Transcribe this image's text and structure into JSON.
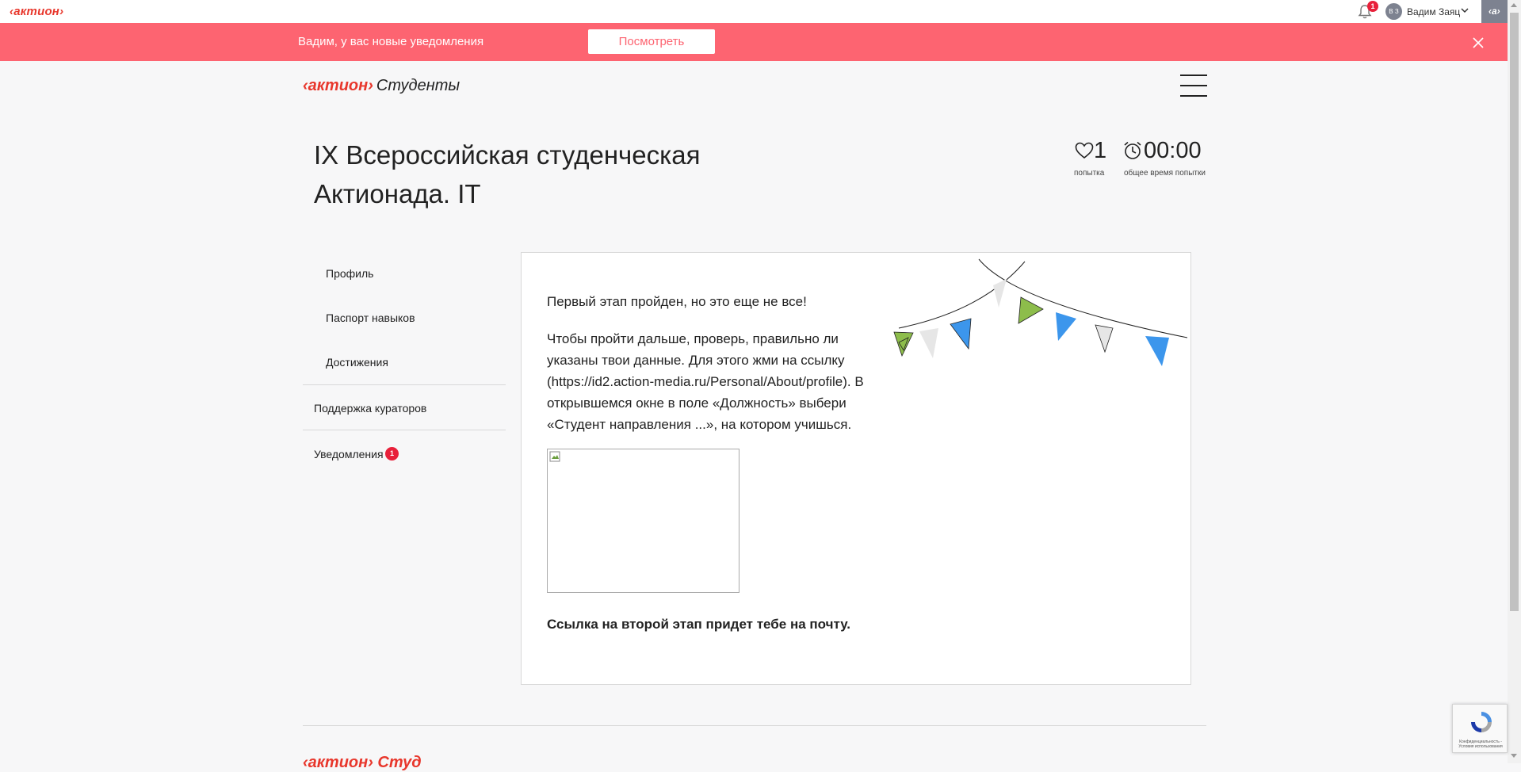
{
  "topbar": {
    "logo": "‹актион›",
    "notification_count": "1",
    "avatar_initials": "В З",
    "user_name": "Вадим Заяц",
    "corner_logo": "‹а›"
  },
  "banner": {
    "text": "Вадим, у вас новые уведомления",
    "button_label": "Посмотреть"
  },
  "header": {
    "brand_logo": "‹актион›",
    "brand_section": "Студенты"
  },
  "page": {
    "title": "IX Всероссийская студенческая Актионада. IT",
    "attempts_value": "1",
    "attempts_label": "попытка",
    "time_value": "00:00",
    "time_label": "общее время попытки"
  },
  "sidebar": {
    "items": [
      {
        "label": "Профиль"
      },
      {
        "label": "Паспорт навыков"
      },
      {
        "label": "Достижения"
      },
      {
        "label": "Поддержка кураторов"
      },
      {
        "label": "Уведомления",
        "badge": "1"
      }
    ]
  },
  "content": {
    "heading": "Первый этап пройден, но это еще не все!",
    "paragraph": "Чтобы пройти дальше, проверь, правильно ли указаны твои данные. Для этого жми на ссылку (https://id2.action-media.ru/Personal/About/profile). В открывшемся окне в поле «Должность» выбери «Студент направления ...», на котором учишься.",
    "bold_note": "Ссылка на второй этап придет тебе на почту."
  },
  "footer": {
    "brand_logo": "‹актион› Студ"
  },
  "recaptcha": {
    "text": "Конфиденциальность - Условия использования"
  },
  "colors": {
    "brand_red": "#e8372c",
    "banner_bg": "#fd6471",
    "badge_red": "#e8203a",
    "flag_green": "#8dbd4b",
    "flag_blue": "#3c96ec",
    "flag_gray": "#e6e6e6"
  }
}
